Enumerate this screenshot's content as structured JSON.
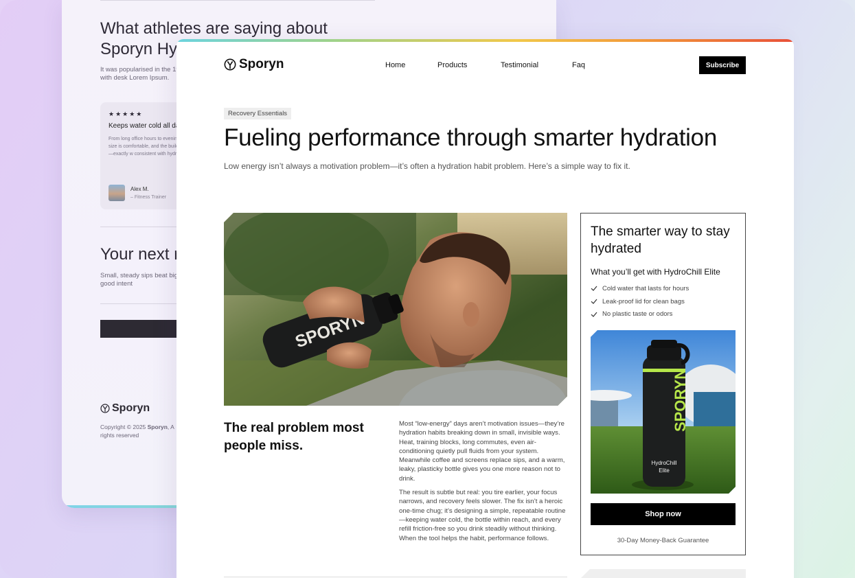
{
  "back_page": {
    "testimonials_heading": "What athletes are saying about Sporyn Hy",
    "testimonials_intro": "It was popularised in the 196 and more recently with desk Lorem Ipsum.",
    "review": {
      "stars": "★★★★★",
      "title": "Keeps water cold all da",
      "body": "From long office hours to evenin everywhere with me. The size is comfortable, and the build qualit stylish, and practical—exactly w consistent with hydration.",
      "name": "Alex M.",
      "role": "– Fitness Trainer"
    },
    "next_heading": "Your next r",
    "next_body": "Small, steady sips beat big, HydroChill turns good intent",
    "footer_logo": "Sporyn",
    "copyright_prefix": "Copyright © 2025 ",
    "copyright_brand": "Sporyn",
    "copyright_suffix": ", A rights reserved"
  },
  "nav": {
    "logo": "Sporyn",
    "links": [
      "Home",
      "Products",
      "Testimonial",
      "Faq"
    ],
    "subscribe": "Subscribe"
  },
  "hero": {
    "tag": "Recovery Essentials",
    "title": "Fueling performance through smarter hydration",
    "subtitle": "Low energy isn’t always a motivation problem—it’s often a hydration habit problem. Here’s a simple way to fix it.",
    "bottle_text": "SPORYN"
  },
  "article": {
    "title": "The real problem most people miss.",
    "p1": "Most “low-energy” days aren’t motivation issues—they’re hydration habits breaking down in small, invisible ways. Heat, training blocks, long commutes, even air-conditioning quietly pull fluids from your system. Meanwhile coffee and screens replace sips, and a warm, leaky, plasticky bottle gives you one more reason not to drink.",
    "p2": "The result is subtle but real: you tire earlier, your focus narrows, and recovery feels slower. The fix isn’t a heroic one-time chug; it’s designing a simple, repeatable routine—keeping water cold, the bottle within reach, and every refill friction-free so you drink steadily without thinking. When the tool helps the habit, performance follows."
  },
  "side_card": {
    "title": "The smarter way to stay hydrated",
    "subtitle": "What you’ll get with HydroChill Elite",
    "benefits": [
      "Cold water that lasts for hours",
      "Leak-proof lid for clean bags",
      "No plastic taste or odors"
    ],
    "product_brand": "SPORYN",
    "product_line1": "HydroChill",
    "product_line2": "Elite",
    "cta": "Shop now",
    "guarantee": "30-Day Money-Back Guarantee"
  },
  "colors": {
    "accent_gradient": [
      "#6cd3de",
      "#9ed28b",
      "#f1c84a",
      "#f29a3a",
      "#e8503a"
    ],
    "product_accent": "#b6e64a",
    "button": "#000000"
  },
  "icons": [
    "sporyn-logo-icon",
    "check-icon"
  ]
}
